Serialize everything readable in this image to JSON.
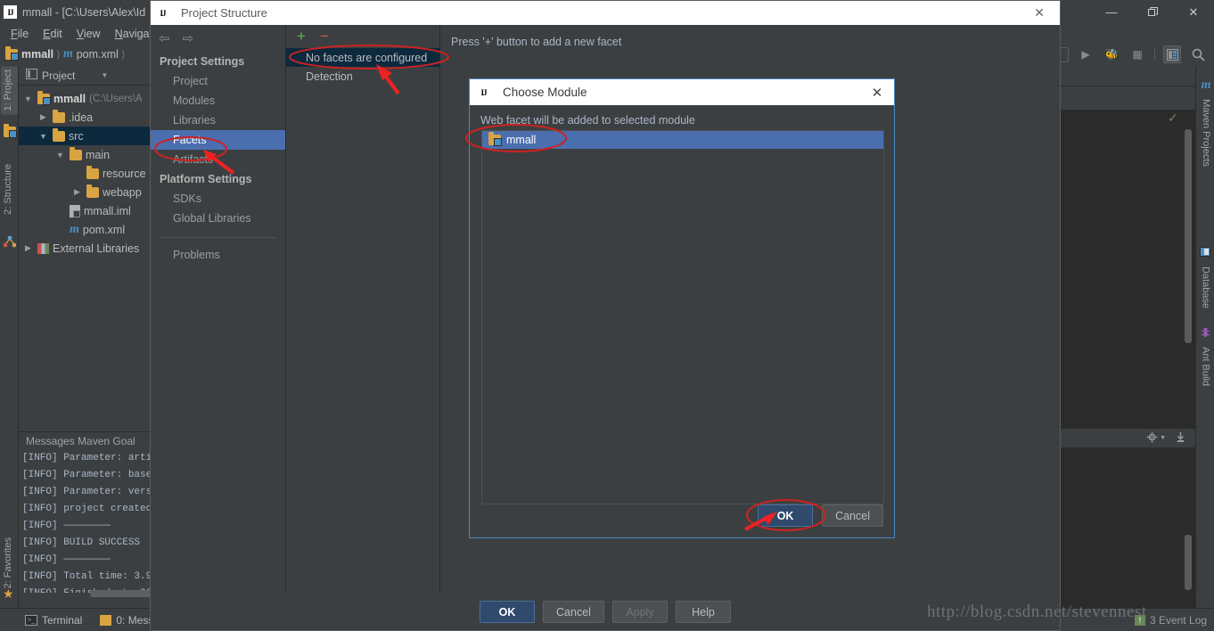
{
  "ide": {
    "title": "mmall - [C:\\Users\\Alex\\Id",
    "logo_text": "IJ",
    "menus": [
      "File",
      "Edit",
      "View",
      "Navigate"
    ],
    "window_buttons": {
      "minimize": "—",
      "maximize": "❐",
      "close": "✕"
    },
    "breadcrumb": [
      {
        "label": "mmall",
        "icon": "module-folder-icon"
      },
      {
        "label": "pom.xml",
        "icon": "maven-m-icon"
      }
    ],
    "toolbar_icons": [
      "run-config-combo",
      "run-icon",
      "debug-icon",
      "coverage-icon",
      "project-structure-icon",
      "search-icon"
    ],
    "left_tabs": [
      {
        "label": "1: Project",
        "active": true
      },
      {
        "label": "2: Structure",
        "active": false
      },
      {
        "label": "2: Favorites",
        "active": false
      }
    ],
    "right_tabs": [
      "Maven Projects",
      "Database",
      "Ant Build"
    ]
  },
  "project_panel": {
    "header_label": "Project",
    "tree": [
      {
        "depth": 0,
        "twisty": "▼",
        "icon": "module-folder-icon",
        "label": "mmall",
        "bold": true,
        "suffix": "(C:\\Users\\A",
        "selected": false
      },
      {
        "depth": 1,
        "twisty": "▶",
        "icon": "folder-icon",
        "label": ".idea",
        "bold": false,
        "suffix": "",
        "selected": false
      },
      {
        "depth": 1,
        "twisty": "▼",
        "icon": "folder-icon",
        "label": "src",
        "bold": false,
        "suffix": "",
        "selected": true
      },
      {
        "depth": 2,
        "twisty": "▼",
        "icon": "folder-icon",
        "label": "main",
        "bold": false,
        "suffix": "",
        "selected": false
      },
      {
        "depth": 3,
        "twisty": "",
        "icon": "folder-icon",
        "label": "resource",
        "bold": false,
        "suffix": "",
        "selected": false
      },
      {
        "depth": 3,
        "twisty": "▶",
        "icon": "folder-icon",
        "label": "webapp",
        "bold": false,
        "suffix": "",
        "selected": false
      },
      {
        "depth": 2,
        "twisty": "",
        "icon": "iml-file-icon",
        "label": "mmall.iml",
        "bold": false,
        "suffix": "",
        "selected": false
      },
      {
        "depth": 2,
        "twisty": "",
        "icon": "maven-m-icon",
        "label": "pom.xml",
        "bold": false,
        "suffix": "",
        "selected": false
      },
      {
        "depth": 0,
        "twisty": "▶",
        "icon": "libraries-icon",
        "label": "External Libraries",
        "bold": false,
        "suffix": "",
        "selected": false
      }
    ]
  },
  "messages_panel": {
    "title": "Messages Maven Goal",
    "lines": [
      "[INFO] Parameter: arti",
      "[INFO] Parameter: base",
      "[INFO] Parameter: vers",
      "[INFO] project created",
      "[INFO] ————————",
      "[INFO] BUILD SUCCESS",
      "[INFO] ————————",
      "[INFO] Total time: 3.9",
      "[INFO] Finished at: 20"
    ]
  },
  "status_bar": {
    "items": [
      {
        "label": "Terminal",
        "icon": "terminal-icon"
      },
      {
        "label": "0: Mess",
        "icon": "messages-icon"
      }
    ],
    "event_log": {
      "label": "3 Event Log",
      "badge": "!"
    }
  },
  "project_structure": {
    "title": "Project Structure",
    "logo_text": "IJ",
    "close_icon": "✕",
    "nav_back": "⇦",
    "nav_forward": "⇨",
    "sections": [
      {
        "group": "Project Settings",
        "items": [
          {
            "label": "Project",
            "selected": false
          },
          {
            "label": "Modules",
            "selected": false
          },
          {
            "label": "Libraries",
            "selected": false
          },
          {
            "label": "Facets",
            "selected": true
          },
          {
            "label": "Artifacts",
            "selected": false
          }
        ]
      },
      {
        "group": "Platform Settings",
        "items": [
          {
            "label": "SDKs",
            "selected": false
          },
          {
            "label": "Global Libraries",
            "selected": false
          }
        ]
      }
    ],
    "problems_label": "Problems",
    "add_icon": "+",
    "remove_icon": "−",
    "facet_rows": [
      {
        "label": "No facets are configured",
        "selected": true
      },
      {
        "label": "Detection",
        "selected": false
      }
    ],
    "hint": "Press '+' button to add a new facet",
    "footer_buttons": [
      {
        "label": "OK",
        "style": "primary"
      },
      {
        "label": "Cancel",
        "style": "normal"
      },
      {
        "label": "Apply",
        "style": "disabled"
      },
      {
        "label": "Help",
        "style": "normal"
      }
    ]
  },
  "choose_module": {
    "title": "Choose Module",
    "logo_text": "IJ",
    "close_icon": "✕",
    "hint": "Web facet will be added to selected module",
    "modules": [
      {
        "label": "mmall",
        "icon": "module-folder-icon",
        "selected": true
      }
    ],
    "buttons": [
      {
        "label": "OK",
        "style": "primary"
      },
      {
        "label": "Cancel",
        "style": "normal"
      }
    ]
  },
  "annotations": {
    "watermark": "http://blog.csdn.net/stevennest",
    "highlight_color": "#cc2222",
    "ellipses": [
      "facets-nav-item",
      "no-facets-row",
      "mmall-module-row",
      "choose-module-ok-button"
    ],
    "arrows": [
      "arrow-to-facets",
      "arrow-to-no-facets",
      "arrow-to-ok"
    ]
  }
}
